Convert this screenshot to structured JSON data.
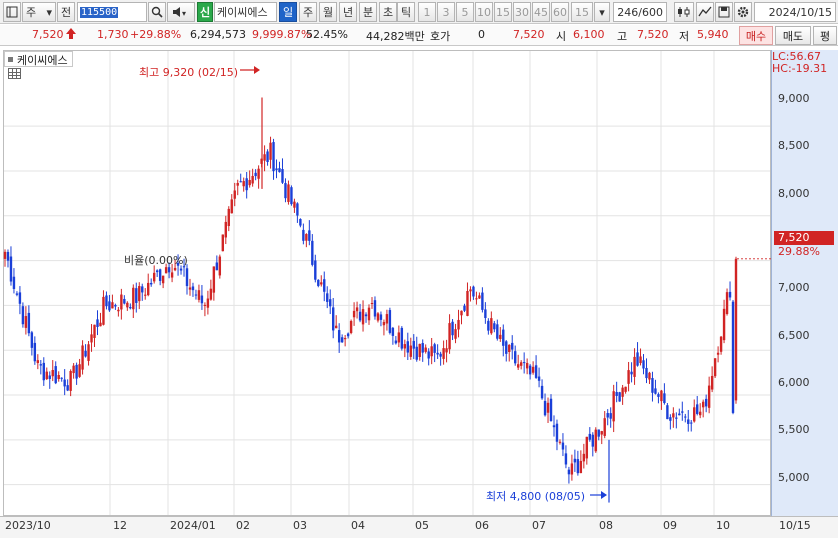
{
  "toolbar": {
    "type_label": "주",
    "market_label": "전",
    "code_value": "115500",
    "badge_label": "신",
    "stock_name": "케이씨에스",
    "period_tabs": [
      "일",
      "주",
      "월",
      "년",
      "분",
      "초",
      "틱"
    ],
    "active_period": "일",
    "minute_options": [
      "1",
      "3",
      "5",
      "10",
      "15",
      "30",
      "45",
      "60"
    ],
    "minute_field": "15",
    "count_value": "246",
    "count_total": "/600",
    "date_value": "2024/10/15",
    "icons": [
      "panel-icon",
      "search-icon",
      "print-icon",
      "speaker-icon",
      "settings-gear-icon"
    ]
  },
  "quote": {
    "price": "7,520",
    "change": "1,730",
    "change_pct": "+29.88%",
    "volume": "6,294,573",
    "volume_pct": "9,999.87%",
    "ratio": "52.45%",
    "amount": "44,282백만",
    "hoga_label": "호가",
    "hoga_value": "0",
    "hoga_price": "7,520",
    "open_label": "시",
    "open_value": "6,100",
    "high_label": "고",
    "high_value": "7,520",
    "low_label": "저",
    "low_value": "5,940",
    "buy_label": "매수",
    "sell_label": "매도",
    "eval_label": "평"
  },
  "chart": {
    "legend": "케이씨에스",
    "lc_label": "LC:56.67",
    "hc_label": "HC:-19.31",
    "last_price_tag": "7,520",
    "last_pct_tag": "29.88%",
    "high_annotation": "최고 9,320 (02/15)",
    "low_annotation": "최저 4,800 (08/05)",
    "rate_annotation": "비율(0.00%)",
    "up_color": "#d12424",
    "down_color": "#1a3fd8"
  },
  "chart_data": {
    "type": "candlestick",
    "x_ticks": [
      "2023/10",
      "12",
      "2024/01",
      "02",
      "03",
      "04",
      "05",
      "06",
      "07",
      "08",
      "09",
      "10",
      "10/15"
    ],
    "y_ticks": [
      "9,000",
      "8,500",
      "8,000",
      "7,500",
      "7,000",
      "6,500",
      "6,000",
      "5,500",
      "5,000"
    ],
    "ylim": [
      4650,
      9850
    ],
    "close_path": [
      {
        "period": "2023/10",
        "close": 7600
      },
      {
        "period": "2023/11",
        "close": 6300
      },
      {
        "period": "2023/11 end",
        "close": 6150
      },
      {
        "period": "2023/12",
        "close": 7000
      },
      {
        "period": "2023/12 end",
        "close": 7100
      },
      {
        "period": "2024/01",
        "close": 7500
      },
      {
        "period": "2024/01 end",
        "close": 7000
      },
      {
        "period": "2024/02",
        "close": 8300
      },
      {
        "period": "2024/02 peak",
        "close": 8700
      },
      {
        "period": "2024/03",
        "close": 7800
      },
      {
        "period": "2024/04",
        "close": 6650
      },
      {
        "period": "2024/05",
        "close": 7050
      },
      {
        "period": "2024/05 end",
        "close": 6600
      },
      {
        "period": "2024/06",
        "close": 6400
      },
      {
        "period": "2024/06 end",
        "close": 7200
      },
      {
        "period": "2024/07",
        "close": 6500
      },
      {
        "period": "2024/07 end",
        "close": 6150
      },
      {
        "period": "2024/08",
        "close": 5100
      },
      {
        "period": "2024/08 mid",
        "close": 5700
      },
      {
        "period": "2024/09",
        "close": 6400
      },
      {
        "period": "2024/09 end",
        "close": 5800
      },
      {
        "period": "2024/10",
        "close": 5800
      },
      {
        "period": "2024/10/15",
        "close": 7520
      }
    ],
    "highest": {
      "value": 9320,
      "date": "02/15"
    },
    "lowest": {
      "value": 4800,
      "date": "08/05"
    },
    "last": {
      "value": 7520,
      "change_pct": 29.88
    }
  }
}
